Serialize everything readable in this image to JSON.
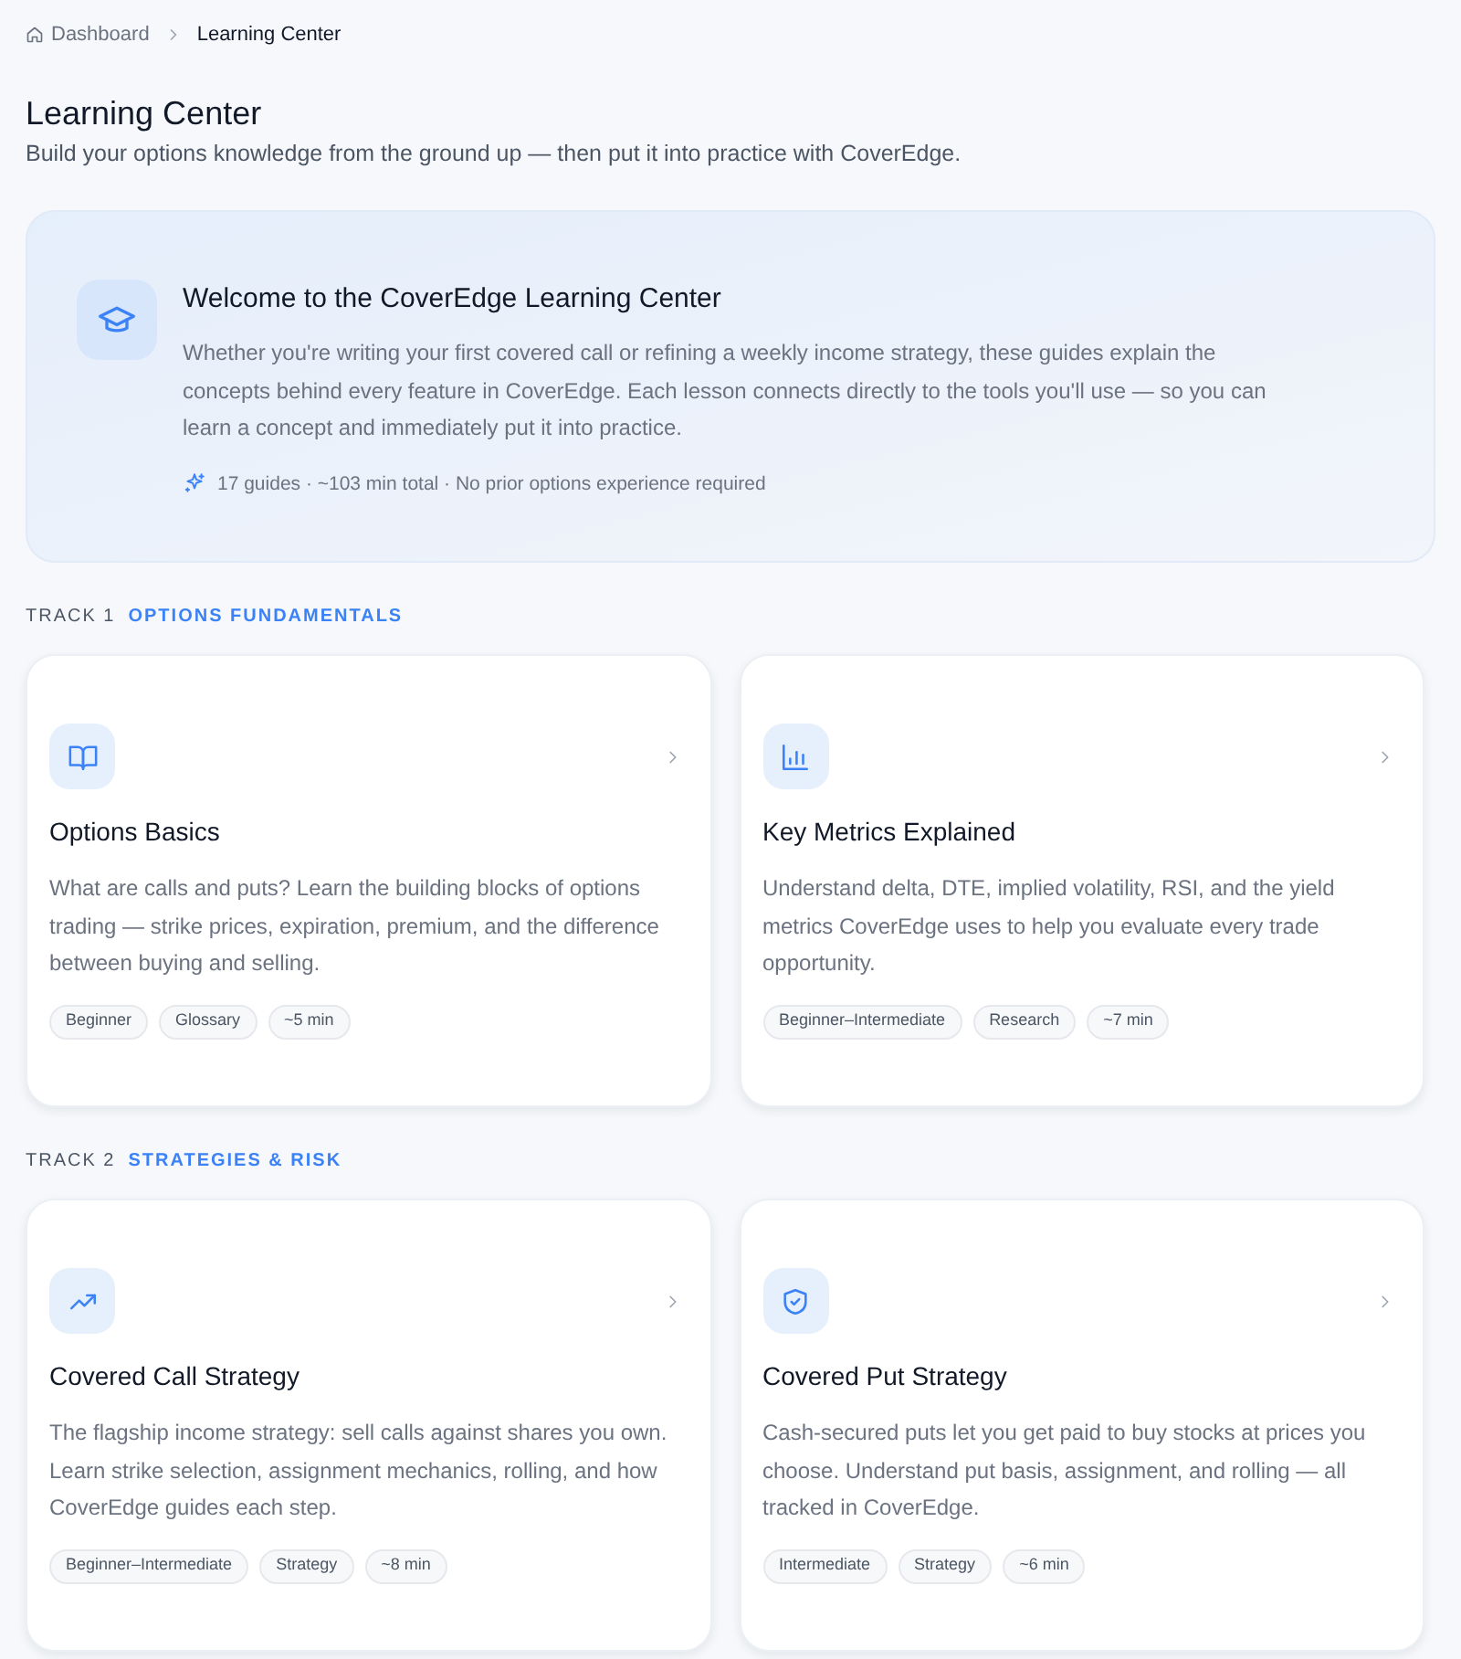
{
  "breadcrumb": [
    {
      "label": "Dashboard",
      "current": false
    },
    {
      "label": "Learning Center",
      "current": true
    }
  ],
  "header": {
    "title": "Learning Center",
    "subtitle": "Build your options knowledge from the ground up — then put it into practice with CoverEdge."
  },
  "welcome": {
    "title": "Welcome to the CoverEdge Learning Center",
    "body": "Whether you're writing your first covered call or refining a weekly income strategy, these guides explain the concepts behind every feature in CoverEdge. Each lesson connects directly to the tools you'll use — so you can learn a concept and immediately put it into practice.",
    "meta": "17 guides · ~103 min total · No prior options experience required"
  },
  "tracks": [
    {
      "number": "TRACK 1",
      "title": "OPTIONS FUNDAMENTALS",
      "guides": [
        {
          "title": "Options Basics",
          "description": "What are calls and puts? Learn the building blocks of options trading — strike prices, expiration, premium, and the difference between buying and selling.",
          "tags": [
            "Beginner",
            "Glossary",
            "~5 min"
          ]
        },
        {
          "title": "Key Metrics Explained",
          "description": "Understand delta, DTE, implied volatility, RSI, and the yield metrics CoverEdge uses to help you evaluate every trade opportunity.",
          "tags": [
            "Beginner–Intermediate",
            "Research",
            "~7 min"
          ]
        }
      ]
    },
    {
      "number": "TRACK 2",
      "title": "STRATEGIES & RISK",
      "guides": [
        {
          "title": "Covered Call Strategy",
          "description": "The flagship income strategy: sell calls against shares you own. Learn strike selection, assignment mechanics, rolling, and how CoverEdge guides each step.",
          "tags": [
            "Beginner–Intermediate",
            "Strategy",
            "~8 min"
          ]
        },
        {
          "title": "Covered Put Strategy",
          "description": "Cash-secured puts let you get paid to buy stocks at prices you choose. Understand put basis, assignment, and rolling — all tracked in CoverEdge.",
          "tags": [
            "Intermediate",
            "Strategy",
            "~6 min"
          ]
        }
      ]
    }
  ]
}
